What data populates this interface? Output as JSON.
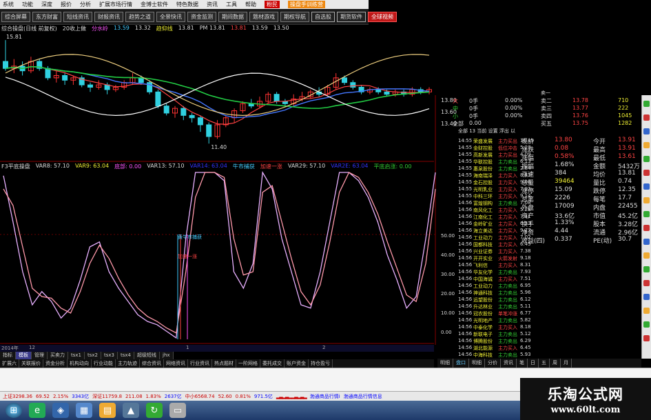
{
  "colors": {
    "up": "#ff3333",
    "down": "#30d0e0",
    "ma5": "#ffffff",
    "ma10": "#f0d080",
    "ma20": "#ff4444",
    "ma30": "#22cc44",
    "ma60": "#4477ff",
    "k": "#e8b0ff",
    "d": "#ff99aa"
  },
  "menubar": [
    "系统",
    "功能",
    "深度",
    "报价",
    "分析",
    "扩展市场行情",
    "金博士软件",
    "特色数据",
    "资讯",
    "工具",
    "帮助"
  ],
  "menubar_red": "粉民",
  "menubar_badge": "操盘手训练营",
  "toolbar": {
    "buttons": [
      "综合屏幕",
      "东方财富",
      "短线资讯",
      "财报资讯",
      "趋势之道",
      "全景快讯",
      "资金监测",
      "期间数据",
      "题材游戏",
      "期权导航"
    ],
    "red_a": "自选股",
    "red_b": "期货软件",
    "red_c": "全球视频"
  },
  "indicators": {
    "main": "综合操盘(日线 前复权)",
    "sub": "20收上做",
    "var_a": "分水岭",
    "var_a_val": "13.59",
    "price1": "13.32",
    "label_ma": "趋仰线",
    "val_ma": "13.81",
    "pm": "PM 13.81",
    "v2": "13.81",
    "v3": "13.59",
    "v4": "13.50"
  },
  "price_labels": {
    "high": "15.81",
    "low": "11.40"
  },
  "axis_main": [
    "13.80",
    "13.60",
    "13.40"
  ],
  "sub_indicators": {
    "title": "F3平底操盘",
    "v1": "VAR8: 57.10",
    "v2": "VAR9: 63.04",
    "v3": "底部: 0.00",
    "v4": "VAR13: 57.10",
    "v5": "VAR14: 63.04",
    "v6": "牛市捕获",
    "v7": "加速一涨",
    "v8": "VAR29: 57.10",
    "v9": "VAR2E: 63.04",
    "v10": "平底启涨: 0.00"
  },
  "overlay_labels": {
    "a": "黄牛市捕获",
    "b": "加速一涨"
  },
  "sub_axis": [
    "50.00",
    "40.00",
    "30.00",
    "20.00",
    "10.00",
    "0.00"
  ],
  "period_bar": "2014年",
  "period_ticks": [
    "12",
    "1",
    "2"
  ],
  "tabs1": [
    "指标",
    "模板",
    "管理",
    "买卖力",
    "tsx1",
    "tsx2",
    "tsx3",
    "tsx4",
    "超级短线",
    "jhx"
  ],
  "tabs2": [
    "扩展六",
    "关联报价",
    "资金分析",
    "机构动向",
    "行业动能",
    "主力轨迹",
    "综合资讯",
    "网络资讯",
    "行业资讯",
    "热点题材",
    "一阶网格",
    "委托成交",
    "账户资金",
    "持仓盈亏"
  ],
  "rtabs": [
    "明细",
    "盘口",
    "明细",
    "分价",
    "资讯",
    "笔",
    "日",
    "五",
    "周",
    "月"
  ],
  "orderbook": [
    {
      "label": "大",
      "hand": "0手",
      "pct": "0.00%",
      "side": "卖二",
      "price": "13.78",
      "vol": "710"
    },
    {
      "label": "中",
      "hand": "0手",
      "pct": "0.00%",
      "side": "卖三",
      "price": "13.77",
      "vol": "222"
    },
    {
      "label": "小",
      "hand": "0手",
      "pct": "0.00%",
      "side": "卖四",
      "price": "13.76",
      "vol": "1045"
    },
    {
      "label": "全部",
      "hand": "0.00",
      "pct": "",
      "side": "买五",
      "price": "13.75",
      "vol": "1282"
    }
  ],
  "orderbook_hdr": {
    "a": "0 1 0 13 当前",
    "b": "全部 13 当前 设置 浮出 以",
    "c": "卖一"
  },
  "quote": [
    {
      "a": "现价",
      "b": "13.80",
      "c": "今开",
      "d": "13.91"
    },
    {
      "a": "涨跌",
      "b": "0.08",
      "c": "最高",
      "d": "13.91"
    },
    {
      "a": "涨幅",
      "b": "0.58%",
      "c": "最低",
      "d": "13.61"
    },
    {
      "a": "振幅",
      "b": "1.68%",
      "c": "金额",
      "d": "5432万"
    },
    {
      "a": "涨速",
      "b": "384",
      "c": "均价",
      "d": "13.81"
    },
    {
      "a": "总量",
      "b": "39464",
      "c": "量比",
      "d": "0.74"
    },
    {
      "a": "涨停",
      "b": "15.09",
      "c": "跌停",
      "d": "12.35"
    },
    {
      "a": "总笔",
      "b": "2226",
      "c": "每笔",
      "d": "17.7"
    },
    {
      "a": "外盘",
      "b": "17009",
      "c": "内盘",
      "d": "22455"
    },
    {
      "a": "资产",
      "b": "33.6亿",
      "c": "市值",
      "d": "45.2亿"
    },
    {
      "a": "换手",
      "b": "1.33%",
      "c": "股本",
      "d": "3.28亿"
    },
    {
      "a": "净资",
      "b": "4.44",
      "c": "流通",
      "d": "2.96亿"
    },
    {
      "a": "收益(四)",
      "b": "0.337",
      "c": "PE(动)",
      "d": "30.7"
    }
  ],
  "ticks": [
    {
      "t": "14:55",
      "n": "荣盛发展",
      "k": "主力买出",
      "v": "16.19"
    },
    {
      "t": "14:55",
      "n": "金财控股",
      "k": "低位冲击",
      "v": "5.27"
    },
    {
      "t": "14:55",
      "n": "高新发展",
      "k": "主力买出",
      "v": "4.09"
    },
    {
      "t": "14:55",
      "n": "华联控股",
      "k": "主力卖出",
      "v": "6.13"
    },
    {
      "t": "14:55",
      "n": "惠泉股份",
      "k": "主力卖出",
      "v": "2.84"
    },
    {
      "t": "14:55",
      "n": "海南瑞泽",
      "k": "主力买入",
      "v": "8.43"
    },
    {
      "t": "14:55",
      "n": "金石控股",
      "k": "主力买入",
      "v": "9.08"
    },
    {
      "t": "14:55",
      "n": "光明乳业",
      "k": "主力买入",
      "v": "7.92"
    },
    {
      "t": "14:55",
      "n": "中科三环",
      "k": "主力买入",
      "v": "9.14"
    },
    {
      "t": "14:56",
      "n": "富煌钢构",
      "k": "主力卖出",
      "v": "7.08"
    },
    {
      "t": "14:56",
      "n": "南风化工",
      "k": "主力买入",
      "v": "5.28"
    },
    {
      "t": "14:56",
      "n": "江南化工",
      "k": "主力买入",
      "v": "7.41"
    },
    {
      "t": "14:56",
      "n": "金岭矿业",
      "k": "主力买入",
      "v": "6.33"
    },
    {
      "t": "14:56",
      "n": "海立美达",
      "k": "主力买入",
      "v": "9.77"
    },
    {
      "t": "14:56",
      "n": "工业动力",
      "k": "主力买入",
      "v": "7.02"
    },
    {
      "t": "14:56",
      "n": "国都科技",
      "k": "主力买入",
      "v": "6.45"
    },
    {
      "t": "14:56",
      "n": "兴业证券",
      "k": "主力买入",
      "v": "7.38"
    },
    {
      "t": "14:56",
      "n": "开开实业",
      "k": "火箭发射",
      "v": "9.18"
    },
    {
      "t": "14:56",
      "n": "飞利信",
      "k": "主力买入",
      "v": "8.31"
    },
    {
      "t": "14:56",
      "n": "华友化学",
      "k": "主力卖出",
      "v": "7.93"
    },
    {
      "t": "14:56",
      "n": "中国海诚",
      "k": "主力买入",
      "v": "7.51"
    },
    {
      "t": "14:56",
      "n": "工业动力",
      "k": "主力卖出",
      "v": "6.95"
    },
    {
      "t": "14:56",
      "n": "神通科技",
      "k": "主力卖出",
      "v": "5.96"
    },
    {
      "t": "14:56",
      "n": "远望股份",
      "k": "主力卖出",
      "v": "6.12"
    },
    {
      "t": "14:56",
      "n": "升达林业",
      "k": "主力卖出",
      "v": "5.11"
    },
    {
      "t": "14:56",
      "n": "冠农股份",
      "k": "单笔冲涨",
      "v": "6.77"
    },
    {
      "t": "14:56",
      "n": "光明地产",
      "k": "主力卖出",
      "v": "5.82"
    },
    {
      "t": "14:56",
      "n": "中泰化学",
      "k": "主力买入",
      "v": "8.18"
    },
    {
      "t": "14:56",
      "n": "新联电子",
      "k": "主力卖出",
      "v": "5.12"
    },
    {
      "t": "14:56",
      "n": "博腾股份",
      "k": "主力卖出",
      "v": "6.29"
    },
    {
      "t": "14:56",
      "n": "湖北能源",
      "k": "主力买入",
      "v": "6.45"
    },
    {
      "t": "14:56",
      "n": "中海科技",
      "k": "主力卖出",
      "v": "5.93"
    }
  ],
  "status": {
    "sh": "上证3298.36",
    "sh_c": "69.52",
    "sh_p": "2.15%",
    "sh_a": "3343亿",
    "sz": "深证11759.8",
    "sz_c": "211.08",
    "sz_p": "1.83%",
    "sz_a": "2637亿",
    "zx": "中小6568.74",
    "zx_c": "52.60",
    "zx_p": "0.81%",
    "zx_a": "971.5亿",
    "news": "渤通商品行情i",
    "news2": "渤通商品行情信息"
  },
  "watermark": {
    "title": "乐淘公式网",
    "url": "www.60lt.com"
  },
  "candles": [
    {
      "o": 14.9,
      "c": 14.6,
      "h": 15.81,
      "l": 14.5
    },
    {
      "o": 14.6,
      "c": 14.7,
      "h": 15.0,
      "l": 14.4
    },
    {
      "o": 14.7,
      "c": 14.5,
      "h": 14.9,
      "l": 14.3
    },
    {
      "o": 14.5,
      "c": 14.9,
      "h": 15.1,
      "l": 14.4
    },
    {
      "o": 14.9,
      "c": 14.6,
      "h": 15.0,
      "l": 14.5
    },
    {
      "o": 14.6,
      "c": 14.2,
      "h": 14.7,
      "l": 14.1
    },
    {
      "o": 14.2,
      "c": 14.3,
      "h": 14.5,
      "l": 14.0
    },
    {
      "o": 14.3,
      "c": 14.1,
      "h": 14.4,
      "l": 13.9
    },
    {
      "o": 14.1,
      "c": 14.2,
      "h": 14.3,
      "l": 13.9
    },
    {
      "o": 14.2,
      "c": 13.9,
      "h": 14.3,
      "l": 13.8
    },
    {
      "o": 13.9,
      "c": 13.8,
      "h": 14.0,
      "l": 13.6
    },
    {
      "o": 13.8,
      "c": 13.9,
      "h": 14.1,
      "l": 13.7
    },
    {
      "o": 13.9,
      "c": 13.7,
      "h": 14.0,
      "l": 13.5
    },
    {
      "o": 13.7,
      "c": 13.8,
      "h": 13.9,
      "l": 13.6
    },
    {
      "o": 13.8,
      "c": 14.0,
      "h": 14.1,
      "l": 13.7
    },
    {
      "o": 14.0,
      "c": 14.2,
      "h": 14.4,
      "l": 13.9
    },
    {
      "o": 14.2,
      "c": 14.0,
      "h": 14.3,
      "l": 13.9
    },
    {
      "o": 14.0,
      "c": 13.6,
      "h": 14.1,
      "l": 13.5
    },
    {
      "o": 13.6,
      "c": 13.0,
      "h": 13.7,
      "l": 12.9
    },
    {
      "o": 13.0,
      "c": 12.7,
      "h": 13.1,
      "l": 12.6
    },
    {
      "o": 12.7,
      "c": 12.9,
      "h": 13.0,
      "l": 12.5
    },
    {
      "o": 12.9,
      "c": 12.6,
      "h": 13.0,
      "l": 12.4
    },
    {
      "o": 12.6,
      "c": 12.5,
      "h": 12.7,
      "l": 12.3
    },
    {
      "o": 12.5,
      "c": 12.2,
      "h": 12.6,
      "l": 11.9
    },
    {
      "o": 12.2,
      "c": 11.7,
      "h": 12.3,
      "l": 11.4
    },
    {
      "o": 11.7,
      "c": 12.2,
      "h": 12.4,
      "l": 11.6
    },
    {
      "o": 12.2,
      "c": 12.5,
      "h": 12.6,
      "l": 12.1
    },
    {
      "o": 12.5,
      "c": 12.8,
      "h": 12.9,
      "l": 12.3
    },
    {
      "o": 12.8,
      "c": 13.1,
      "h": 13.2,
      "l": 12.7
    },
    {
      "o": 13.1,
      "c": 13.0,
      "h": 13.3,
      "l": 12.9
    },
    {
      "o": 13.0,
      "c": 13.2,
      "h": 13.4,
      "l": 12.9
    },
    {
      "o": 13.2,
      "c": 13.5,
      "h": 13.6,
      "l": 13.1
    },
    {
      "o": 13.5,
      "c": 13.2,
      "h": 13.6,
      "l": 13.1
    },
    {
      "o": 13.2,
      "c": 13.1,
      "h": 13.3,
      "l": 13.0
    },
    {
      "o": 13.1,
      "c": 13.3,
      "h": 13.5,
      "l": 13.0
    },
    {
      "o": 13.3,
      "c": 13.4,
      "h": 13.6,
      "l": 13.2
    },
    {
      "o": 13.4,
      "c": 13.6,
      "h": 13.7,
      "l": 13.3
    },
    {
      "o": 13.6,
      "c": 13.5,
      "h": 13.8,
      "l": 13.4
    },
    {
      "o": 13.5,
      "c": 13.8,
      "h": 13.9,
      "l": 13.4
    },
    {
      "o": 13.8,
      "c": 14.2,
      "h": 14.4,
      "l": 13.7
    },
    {
      "o": 14.2,
      "c": 14.0,
      "h": 14.3,
      "l": 13.9
    },
    {
      "o": 14.0,
      "c": 13.8,
      "h": 14.1,
      "l": 13.7
    },
    {
      "o": 13.8,
      "c": 13.6,
      "h": 13.9,
      "l": 13.5
    },
    {
      "o": 13.6,
      "c": 13.7,
      "h": 13.8,
      "l": 13.5
    },
    {
      "o": 13.7,
      "c": 13.6,
      "h": 13.8,
      "l": 13.5
    },
    {
      "o": 13.6,
      "c": 13.5,
      "h": 13.7,
      "l": 13.4
    },
    {
      "o": 13.5,
      "c": 13.6,
      "h": 13.7,
      "l": 13.4
    },
    {
      "o": 13.6,
      "c": 13.5,
      "h": 13.7,
      "l": 13.4
    },
    {
      "o": 13.5,
      "c": 13.7,
      "h": 13.8,
      "l": 13.4
    },
    {
      "o": 13.7,
      "c": 13.6,
      "h": 13.8,
      "l": 13.5
    },
    {
      "o": 13.6,
      "c": 13.7,
      "h": 13.8,
      "l": 13.5
    }
  ]
}
